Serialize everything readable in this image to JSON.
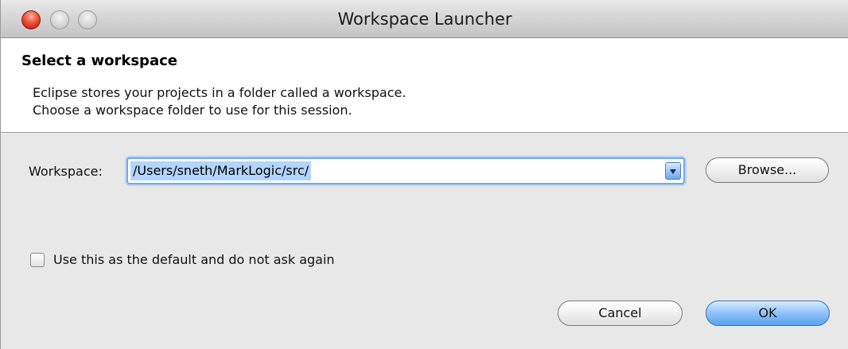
{
  "window": {
    "title": "Workspace Launcher"
  },
  "header": {
    "title": "Select a workspace",
    "description_line1": "Eclipse stores your projects in a folder called a workspace.",
    "description_line2": "Choose a workspace folder to use for this session."
  },
  "workspace": {
    "label": "Workspace:",
    "value": "/Users/sneth/MarkLogic/src/",
    "browse_label": "Browse..."
  },
  "default_option": {
    "label": "Use this as the default and do not ask again",
    "checked": false
  },
  "actions": {
    "cancel_label": "Cancel",
    "ok_label": "OK"
  },
  "colors": {
    "accent": "#5aa0ef",
    "close_light": "#f0513a",
    "selection": "#b3d4fd"
  }
}
